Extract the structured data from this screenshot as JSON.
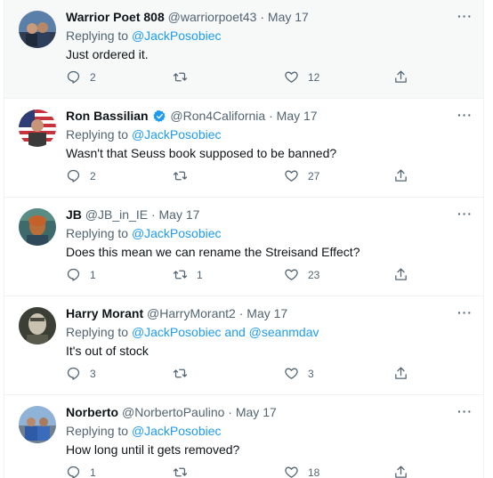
{
  "replying_prefix": "Replying to",
  "more_glyph": "···",
  "tweets": [
    {
      "name": "Warrior Poet 808",
      "handle": "@warriorpoet43",
      "sep": "·",
      "date": "May 17",
      "verified": false,
      "reply_to": "@JackPosobiec",
      "reply_and": "",
      "reply_to2": "",
      "text": "Just ordered it.",
      "replies": "2",
      "retweets": "",
      "likes": "12"
    },
    {
      "name": "Ron Bassilian",
      "handle": "@Ron4California",
      "sep": "·",
      "date": "May 17",
      "verified": true,
      "reply_to": "@JackPosobiec",
      "reply_and": "",
      "reply_to2": "",
      "text": "Wasn't that Seuss book supposed to be banned?",
      "replies": "2",
      "retweets": "",
      "likes": "27"
    },
    {
      "name": "JB",
      "handle": "@JB_in_IE",
      "sep": "·",
      "date": "May 17",
      "verified": false,
      "reply_to": "@JackPosobiec",
      "reply_and": "",
      "reply_to2": "",
      "text": "Does this mean we can rename the Streisand Effect?",
      "replies": "1",
      "retweets": "1",
      "likes": "23"
    },
    {
      "name": "Harry Morant",
      "handle": "@HarryMorant2",
      "sep": "·",
      "date": "May 17",
      "verified": false,
      "reply_to": "@JackPosobiec",
      "reply_and": "and",
      "reply_to2": "@seanmdav",
      "text": "It's out of stock",
      "replies": "3",
      "retweets": "",
      "likes": "3"
    },
    {
      "name": "Norberto",
      "handle": "@NorbertoPaulino",
      "sep": "·",
      "date": "May 17",
      "verified": false,
      "reply_to": "@JackPosobiec",
      "reply_and": "",
      "reply_to2": "",
      "text": "How long until it gets removed?",
      "replies": "1",
      "retweets": "",
      "likes": "18"
    }
  ],
  "colors": {
    "accent": "#1d9bf0",
    "muted": "#536471",
    "text": "#0f1419",
    "divider": "#eff3f4"
  }
}
